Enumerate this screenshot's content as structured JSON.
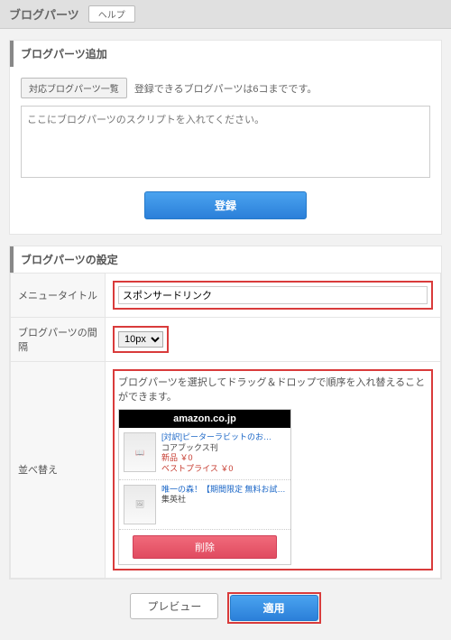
{
  "header": {
    "title": "ブログパーツ",
    "help_label": "ヘルプ"
  },
  "add_section": {
    "title": "ブログパーツ追加",
    "list_button": "対応ブログパーツ一覧",
    "limit_hint": "登録できるブログパーツは6コまでです。",
    "placeholder": "ここにブログパーツのスクリプトを入れてください。",
    "submit_label": "登録"
  },
  "settings_section": {
    "title": "ブログパーツの設定",
    "rows": {
      "menu_title": {
        "label": "メニュータイトル",
        "value": "スポンサードリンク"
      },
      "gap": {
        "label": "ブログパーツの間隔",
        "options": [
          "10px"
        ],
        "selected": "10px"
      },
      "sort": {
        "label": "並べ替え",
        "desc": "ブログパーツを選択してドラッグ＆ドロップで順序を入れ替えることができます。",
        "widget": {
          "head": "amazon.co.jp",
          "items": [
            {
              "title": "[対訳]ピーターラビットのお…",
              "maker": "コアブックス刊",
              "price1": "新品 ￥0",
              "price2": "ベストプライス ￥0"
            },
            {
              "title": "唯一の森！【期間限定 無料お試…",
              "maker": "集英社"
            }
          ],
          "delete_label": "削除"
        }
      }
    }
  },
  "footer": {
    "preview_label": "プレビュー",
    "apply_label": "適用"
  }
}
